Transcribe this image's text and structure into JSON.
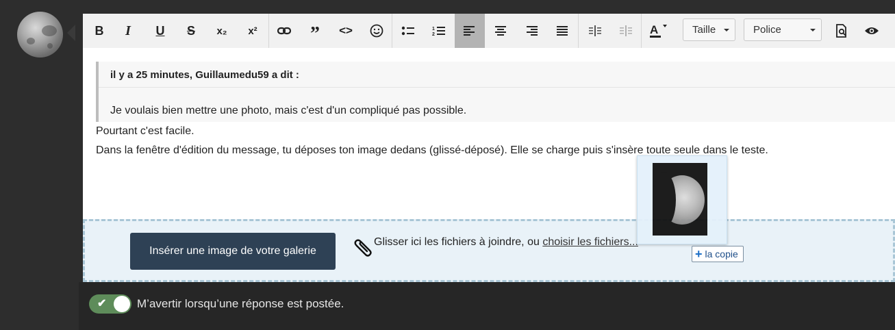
{
  "toolbar": {
    "bold": "B",
    "italic": "I",
    "underline": "U",
    "strike": "S",
    "subscript": "x₂",
    "superscript": "x²",
    "quote": "”",
    "code": "<>",
    "size_label": "Taille",
    "font_label": "Police"
  },
  "post": {
    "quote_attribution": "il y a 25 minutes, Guillaumedu59 a dit :",
    "quote_text": "Je voulais bien mettre une photo, mais c'est d'un compliqué pas possible.",
    "line1": "Pourtant c'est facile.",
    "line2": "Dans la fenêtre d'édition du message, tu déposes ton image dedans (glissé-déposé). Elle se charge puis s'insère toute seule dans le teste."
  },
  "dropzone": {
    "gallery_button": "Insérer une image de votre galerie",
    "drop_text": "Glisser ici les fichiers à joindre, ou ",
    "choose_link": "choisir les fichiers..."
  },
  "drag": {
    "copy_label": "la copie"
  },
  "footer": {
    "notify_label": "M’avertir lorsqu’une réponse est postée.",
    "notify_enabled": true
  },
  "colors": {
    "toolbar_bg": "#f1f1f1",
    "active_btn": "#b3b3b3",
    "gallery_btn": "#2e4155",
    "dropzone_bg": "#e9f2f8",
    "toggle_on": "#5e8c5a"
  }
}
